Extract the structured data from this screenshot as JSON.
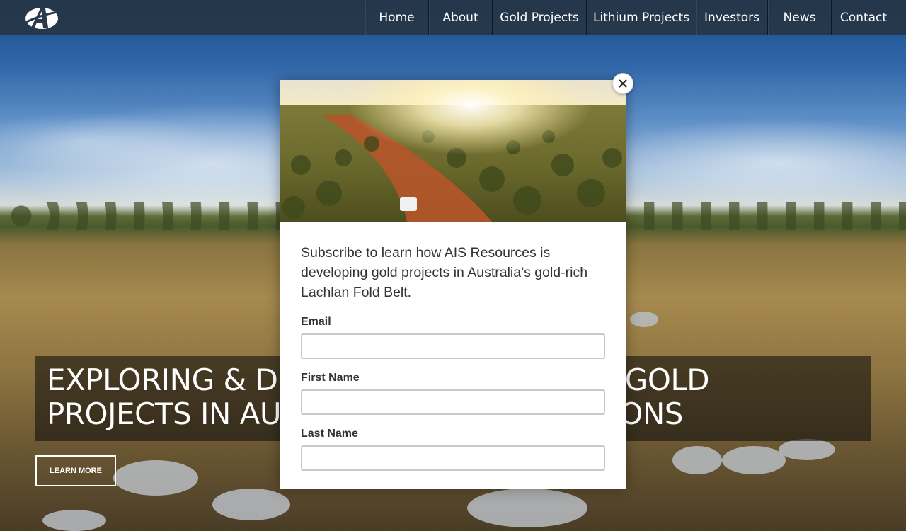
{
  "nav": {
    "items": [
      {
        "label": "Home"
      },
      {
        "label": "About"
      },
      {
        "label": "Gold Projects"
      },
      {
        "label": "Lithium Projects"
      },
      {
        "label": "Investors"
      },
      {
        "label": "News"
      },
      {
        "label": "Contact"
      }
    ]
  },
  "hero": {
    "headline_line1": "EXPLORING & DEVELOPING ADVANCED GOLD",
    "headline_line2": "PROJECTS IN AUSTRALIAN MINING REGIONS",
    "learn_more": "LEARN MORE"
  },
  "modal": {
    "intro": "Subscribe to learn how AIS Resources is developing gold projects in Australia’s gold-rich Lachlan Fold Belt.",
    "fields": [
      {
        "label": "Email",
        "value": ""
      },
      {
        "label": "First Name",
        "value": ""
      },
      {
        "label": "Last Name",
        "value": ""
      }
    ],
    "close_icon": "close-icon"
  },
  "logo": {
    "icon": "ais-logo-icon"
  }
}
